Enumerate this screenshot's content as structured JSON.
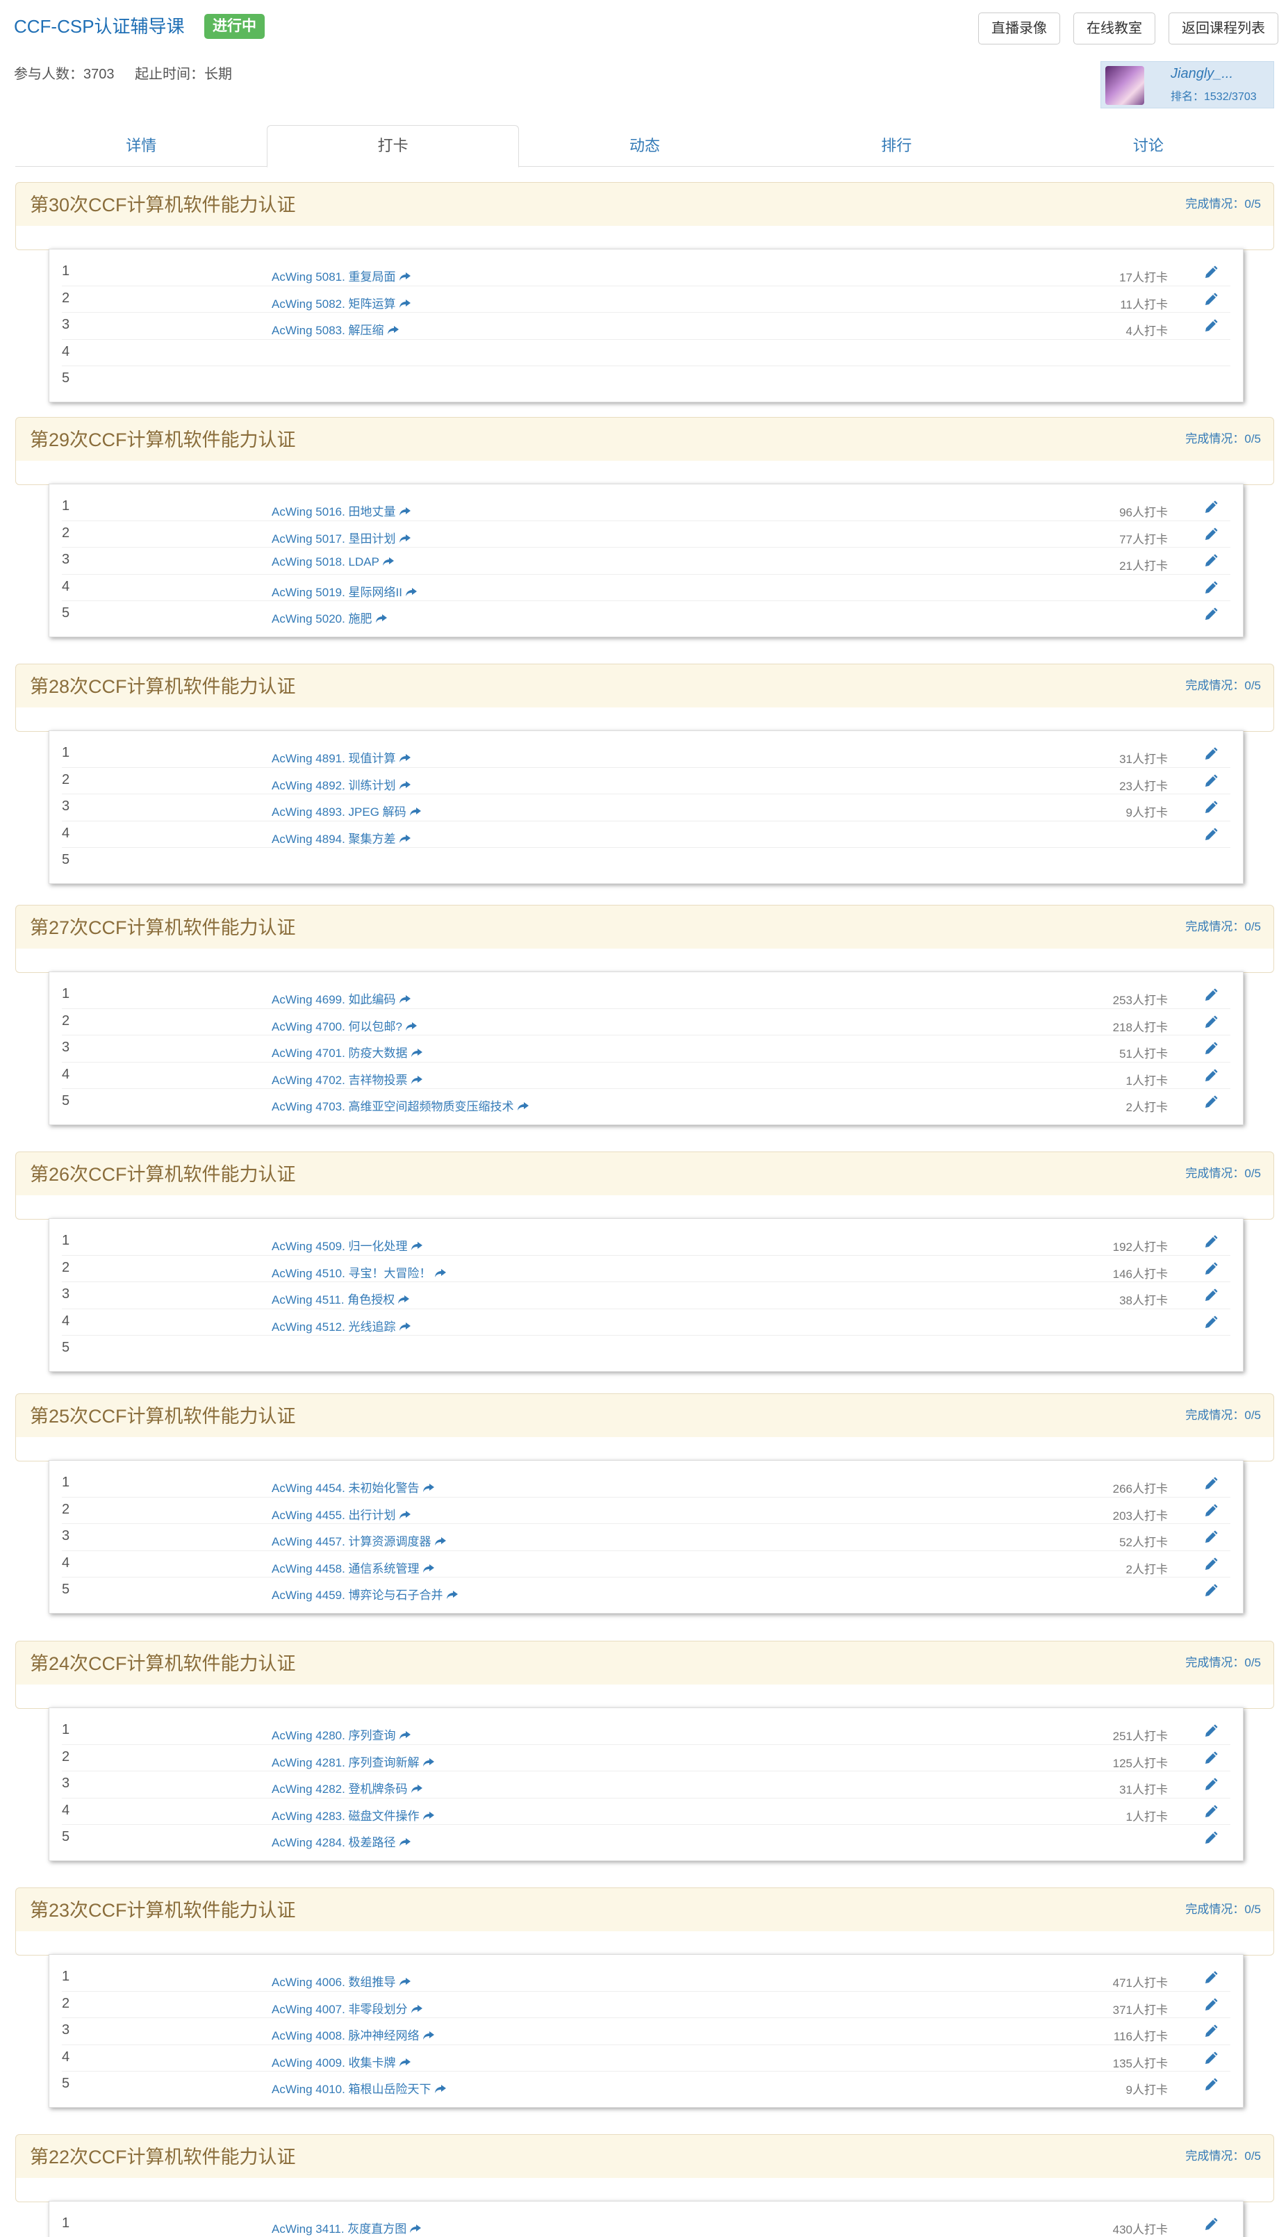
{
  "header": {
    "course_title": "CCF-CSP认证辅导课",
    "status": "进行中",
    "participants": "参与人数：3703",
    "deadline": "起止时间：长期",
    "buttons": {
      "live": "直播录像",
      "online": "在线教室",
      "back": "返回课程列表"
    }
  },
  "user": {
    "name": "Jiangly_...",
    "rank": "排名：1532/3703",
    "avatar_icon": "avatar-image"
  },
  "tabs": [
    "详情",
    "打卡",
    "动态",
    "排行",
    "讨论"
  ],
  "active_tab": "打卡",
  "colors": {
    "link": "#337ab7",
    "badge": "#5cb85c",
    "contest_header_bg": "#fcf7e6",
    "contest_title": "#8a6d3b"
  },
  "contests": [
    {
      "title": "第30次CCF计算机软件能力认证",
      "progress": "完成情况：0/5",
      "problems": [
        {
          "num": "1",
          "title": "AcWing 5081. 重复局面",
          "count": "17人打卡"
        },
        {
          "num": "2",
          "title": "AcWing 5082. 矩阵运算",
          "count": "11人打卡"
        },
        {
          "num": "3",
          "title": "AcWing 5083. 解压缩",
          "count": "4人打卡"
        },
        {
          "num": "4",
          "title": "",
          "count": ""
        },
        {
          "num": "5",
          "title": "",
          "count": ""
        }
      ]
    },
    {
      "title": "第29次CCF计算机软件能力认证",
      "progress": "完成情况：0/5",
      "problems": [
        {
          "num": "1",
          "title": "AcWing 5016. 田地丈量",
          "count": "96人打卡"
        },
        {
          "num": "2",
          "title": "AcWing 5017. 垦田计划",
          "count": "77人打卡"
        },
        {
          "num": "3",
          "title": "AcWing 5018. LDAP",
          "count": "21人打卡"
        },
        {
          "num": "4",
          "title": "AcWing 5019. 星际网络II",
          "count": ""
        },
        {
          "num": "5",
          "title": "AcWing 5020. 施肥",
          "count": ""
        }
      ]
    },
    {
      "title": "第28次CCF计算机软件能力认证",
      "progress": "完成情况：0/5",
      "problems": [
        {
          "num": "1",
          "title": "AcWing 4891. 现值计算",
          "count": "31人打卡"
        },
        {
          "num": "2",
          "title": "AcWing 4892. 训练计划",
          "count": "23人打卡"
        },
        {
          "num": "3",
          "title": "AcWing 4893. JPEG 解码",
          "count": "9人打卡"
        },
        {
          "num": "4",
          "title": "AcWing 4894. 聚集方差",
          "count": ""
        },
        {
          "num": "5",
          "title": "",
          "count": ""
        }
      ]
    },
    {
      "title": "第27次CCF计算机软件能力认证",
      "progress": "完成情况：0/5",
      "problems": [
        {
          "num": "1",
          "title": "AcWing 4699. 如此编码",
          "count": "253人打卡"
        },
        {
          "num": "2",
          "title": "AcWing 4700. 何以包邮?",
          "count": "218人打卡"
        },
        {
          "num": "3",
          "title": "AcWing 4701. 防疫大数据",
          "count": "51人打卡"
        },
        {
          "num": "4",
          "title": "AcWing 4702. 吉祥物投票",
          "count": "1人打卡"
        },
        {
          "num": "5",
          "title": "AcWing 4703. 高维亚空间超频物质变压缩技术",
          "count": "2人打卡"
        }
      ]
    },
    {
      "title": "第26次CCF计算机软件能力认证",
      "progress": "完成情况：0/5",
      "problems": [
        {
          "num": "1",
          "title": "AcWing 4509. 归一化处理",
          "count": "192人打卡"
        },
        {
          "num": "2",
          "title": "AcWing 4510. 寻宝！大冒险！",
          "count": "146人打卡"
        },
        {
          "num": "3",
          "title": "AcWing 4511. 角色授权",
          "count": "38人打卡"
        },
        {
          "num": "4",
          "title": "AcWing 4512. 光线追踪",
          "count": ""
        },
        {
          "num": "5",
          "title": "",
          "count": ""
        }
      ]
    },
    {
      "title": "第25次CCF计算机软件能力认证",
      "progress": "完成情况：0/5",
      "problems": [
        {
          "num": "1",
          "title": "AcWing 4454. 未初始化警告",
          "count": "266人打卡"
        },
        {
          "num": "2",
          "title": "AcWing 4455. 出行计划",
          "count": "203人打卡"
        },
        {
          "num": "3",
          "title": "AcWing 4457. 计算资源调度器",
          "count": "52人打卡"
        },
        {
          "num": "4",
          "title": "AcWing 4458. 通信系统管理",
          "count": "2人打卡"
        },
        {
          "num": "5",
          "title": "AcWing 4459. 博弈论与石子合并",
          "count": ""
        }
      ]
    },
    {
      "title": "第24次CCF计算机软件能力认证",
      "progress": "完成情况：0/5",
      "problems": [
        {
          "num": "1",
          "title": "AcWing 4280. 序列查询",
          "count": "251人打卡"
        },
        {
          "num": "2",
          "title": "AcWing 4281. 序列查询新解",
          "count": "125人打卡"
        },
        {
          "num": "3",
          "title": "AcWing 4282. 登机牌条码",
          "count": "31人打卡"
        },
        {
          "num": "4",
          "title": "AcWing 4283. 磁盘文件操作",
          "count": "1人打卡"
        },
        {
          "num": "5",
          "title": "AcWing 4284. 极差路径",
          "count": ""
        }
      ]
    },
    {
      "title": "第23次CCF计算机软件能力认证",
      "progress": "完成情况：0/5",
      "problems": [
        {
          "num": "1",
          "title": "AcWing 4006. 数组推导",
          "count": "471人打卡"
        },
        {
          "num": "2",
          "title": "AcWing 4007. 非零段划分",
          "count": "371人打卡"
        },
        {
          "num": "3",
          "title": "AcWing 4008. 脉冲神经网络",
          "count": "116人打卡"
        },
        {
          "num": "4",
          "title": "AcWing 4009. 收集卡牌",
          "count": "135人打卡"
        },
        {
          "num": "5",
          "title": "AcWing 4010. 箱根山岳险天下",
          "count": "9人打卡"
        }
      ]
    },
    {
      "title": "第22次CCF计算机软件能力认证",
      "progress": "完成情况：0/5",
      "problems": [
        {
          "num": "1",
          "title": "AcWing 3411. 灰度直方图",
          "count": "430人打卡"
        }
      ]
    }
  ]
}
